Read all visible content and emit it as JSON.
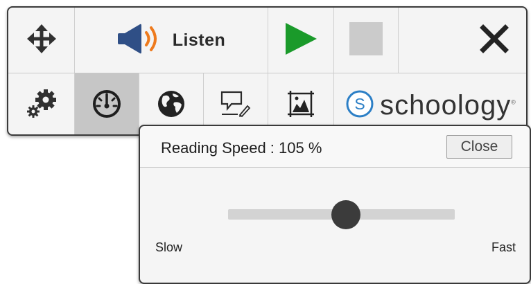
{
  "toolbar": {
    "listen_label": "Listen",
    "brand_name": "schoology",
    "brand_logo_letter": "S",
    "trademark": "®"
  },
  "icons": {
    "move": "move-arrows-icon",
    "speaker": "speaker-icon",
    "play": "play-icon",
    "stop": "stop-icon",
    "close": "close-icon",
    "settings": "gears-icon",
    "speed": "speedometer-icon",
    "translate": "globe-icon",
    "annotate": "annotate-icon",
    "picture": "picture-dictionary-icon",
    "schoology": "schoology-logo-icon"
  },
  "colors": {
    "play": "#1a9a2a",
    "speaker_body": "#2f4f86",
    "speaker_waves": "#ee7a1d",
    "brand": "#2c7fc6",
    "selected_cell": "#c6c6c6",
    "stop_square": "#cbcbcb"
  },
  "speed_popup": {
    "title": "Reading Speed : 105 %",
    "close_label": "Close",
    "min_label": "Slow",
    "max_label": "Fast",
    "value_percent": 105
  }
}
